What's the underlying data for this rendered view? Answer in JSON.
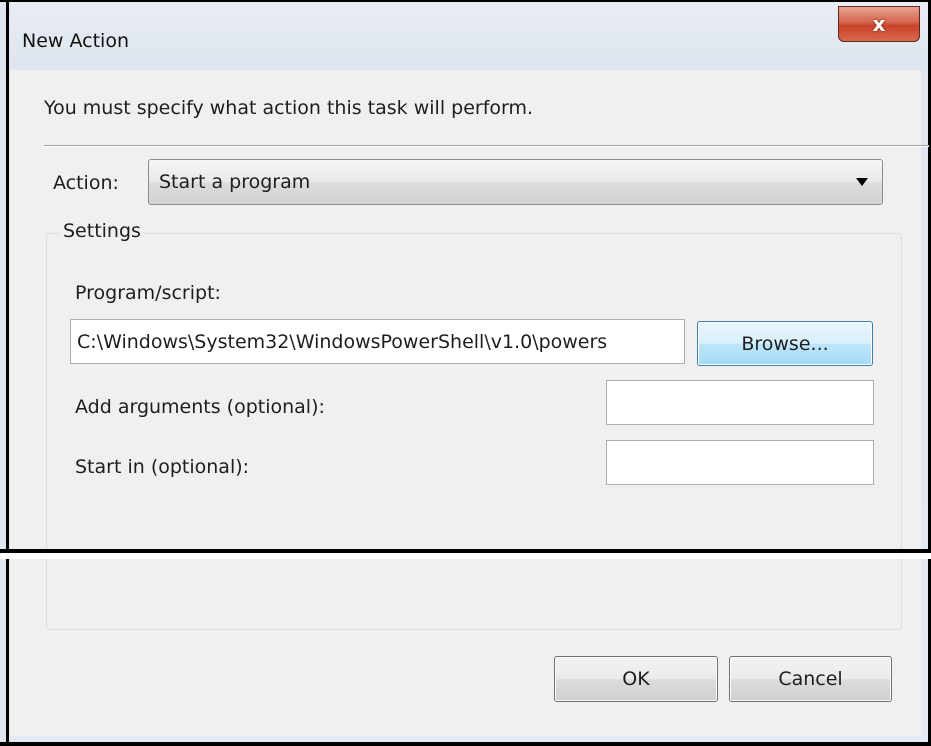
{
  "window": {
    "title": "New Action",
    "close_glyph": "x"
  },
  "instruction": "You must specify what action this task will perform.",
  "action": {
    "label": "Action:",
    "selected": "Start a program"
  },
  "settings": {
    "legend": "Settings",
    "program_label": "Program/script:",
    "program_value": "C:\\Windows\\System32\\WindowsPowerShell\\v1.0\\powers",
    "browse_label": "Browse...",
    "args_label": "Add arguments (optional):",
    "args_value": "",
    "startin_label": "Start in (optional):",
    "startin_value": ""
  },
  "buttons": {
    "ok": "OK",
    "cancel": "Cancel"
  },
  "colors": {
    "close_button": "#c7432a",
    "browse_focus": "#3c7fb1",
    "dialog_bg": "#f0f0f0"
  }
}
